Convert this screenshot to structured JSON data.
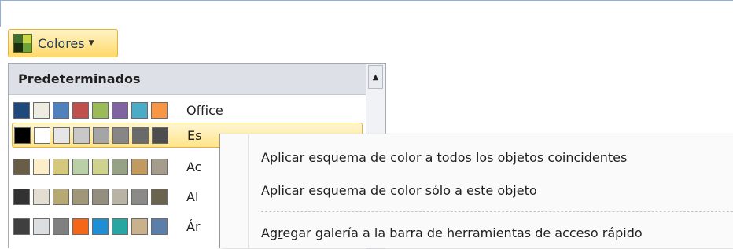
{
  "colors_button": {
    "label": "Colores",
    "icon": "color-scheme-icon",
    "arrow": "dropdown-arrow-icon"
  },
  "gallery": {
    "header": "Predeterminados",
    "scroll_up_icon": "scroll-up-arrow-icon",
    "schemes": [
      {
        "label": "Office",
        "colors": [
          "#1f497d",
          "#eeece1",
          "#4f81bd",
          "#c0504d",
          "#9bbb59",
          "#8064a2",
          "#4bacc6",
          "#f79646"
        ]
      },
      {
        "label": "Es",
        "colors": [
          "#000000",
          "#ffffff",
          "#e6e6e6",
          "#c8c8c8",
          "#a5a5a5",
          "#868686",
          "#6a6a6a",
          "#4d4d4d"
        ]
      },
      {
        "label": "Ac",
        "colors": [
          "#695d46",
          "#fbeec9",
          "#d4c87c",
          "#b9cfa6",
          "#cfd28d",
          "#96a185",
          "#c29a5f",
          "#a69c8e"
        ]
      },
      {
        "label": "Al",
        "colors": [
          "#323232",
          "#e3ded1",
          "#b7a973",
          "#a09779",
          "#938e7e",
          "#b8b3a5",
          "#8b8a88",
          "#6a634e"
        ]
      },
      {
        "label": "Ár",
        "colors": [
          "#3f3f3f",
          "#dcdfe1",
          "#808080",
          "#f56617",
          "#1f8ed3",
          "#28a6a1",
          "#c8b18b",
          "#5b7fa9"
        ]
      }
    ]
  },
  "context_menu": {
    "items": [
      {
        "label": "Aplicar esquema de color a todos los objetos coincidentes"
      },
      {
        "label": "Aplicar esquema de color sólo a este objeto"
      },
      {
        "label_pre": "Ag",
        "label_underline": "r",
        "label_post": "egar galería a la barra de herramientas de acceso rápido"
      }
    ]
  }
}
